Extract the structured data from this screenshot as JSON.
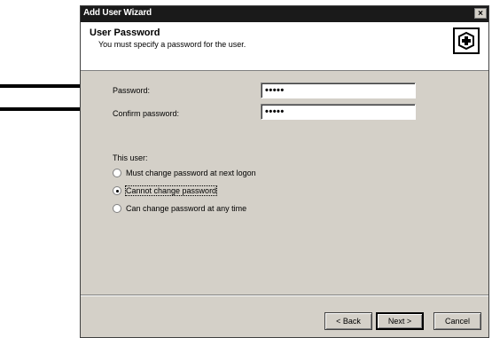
{
  "window": {
    "title": "Add User Wizard",
    "close_label": "×"
  },
  "header": {
    "title": "User Password",
    "subtitle": "You must specify a password for the user.",
    "icon": "wizard-key-icon"
  },
  "fields": {
    "password_label": "Password:",
    "password_value": "•••••",
    "confirm_label": "Confirm password:",
    "confirm_value": "•••••"
  },
  "options": {
    "group_label": "This user:",
    "items": [
      {
        "label": "Must change password at next logon",
        "checked": false
      },
      {
        "label": "Cannot change password",
        "checked": true
      },
      {
        "label": "Can change password at any time",
        "checked": false
      }
    ]
  },
  "buttons": {
    "back": "< Back",
    "next": "Next >",
    "cancel": "Cancel"
  },
  "colors": {
    "dialog_bg": "#d4d0c8",
    "titlebar_bg": "#1a1a1a",
    "arrow": "#000000"
  }
}
